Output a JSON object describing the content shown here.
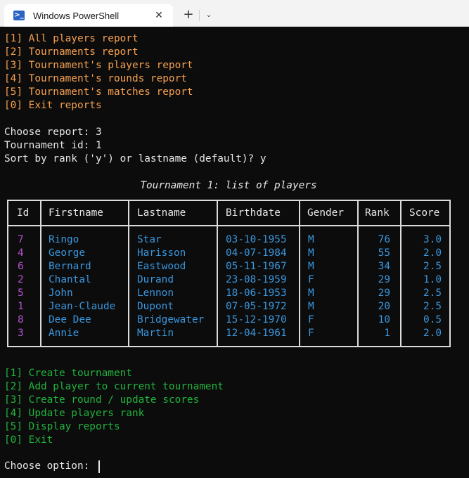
{
  "window": {
    "tab_title": "Windows PowerShell",
    "tab_icon": "powershell-icon",
    "close_glyph": "✕",
    "newtab_glyph": "+",
    "dropdown_glyph": "⌄"
  },
  "reports_menu": [
    "[1] All players report",
    "[2] Tournaments report",
    "[3] Tournament's players report",
    "[4] Tournament's rounds report",
    "[5] Tournament's matches report",
    "[0] Exit reports"
  ],
  "prompts": [
    "Choose report: 3",
    "Tournament id: 1",
    "Sort by rank ('y') or lastname (default)? y"
  ],
  "table": {
    "title": "Tournament 1: list of players",
    "headers": [
      "Id",
      "Firstname",
      "Lastname",
      "Birthdate",
      "Gender",
      "Rank",
      "Score"
    ],
    "rows": [
      [
        "7",
        "Ringo",
        "Star",
        "03-10-1955",
        "M",
        "76",
        "3.0"
      ],
      [
        "4",
        "George",
        "Harisson",
        "04-07-1984",
        "M",
        "55",
        "2.0"
      ],
      [
        "6",
        "Bernard",
        "Eastwood",
        "05-11-1967",
        "M",
        "34",
        "2.5"
      ],
      [
        "2",
        "Chantal",
        "Durand",
        "23-08-1959",
        "F",
        "29",
        "1.0"
      ],
      [
        "5",
        "John",
        "Lennon",
        "18-06-1953",
        "M",
        "29",
        "2.5"
      ],
      [
        "1",
        "Jean-Claude",
        "Dupont",
        "07-05-1972",
        "M",
        "20",
        "2.5"
      ],
      [
        "8",
        "Dee Dee",
        "Bridgewater",
        "15-12-1970",
        "F",
        "10",
        "0.5"
      ],
      [
        "3",
        "Annie",
        "Martin",
        "12-04-1961",
        "F",
        "1",
        "2.0"
      ]
    ]
  },
  "main_menu": [
    "[1] Create tournament",
    "[2] Add player to current tournament",
    "[3] Create round / update scores",
    "[4] Update players rank",
    "[5] Display reports",
    "[0] Exit"
  ],
  "final_prompt": "Choose option: ",
  "colors": {
    "background": "#0c0c0c",
    "orange": "#f5a050",
    "green": "#21b33d",
    "blue": "#3a96dd",
    "purple": "#b452cd"
  }
}
